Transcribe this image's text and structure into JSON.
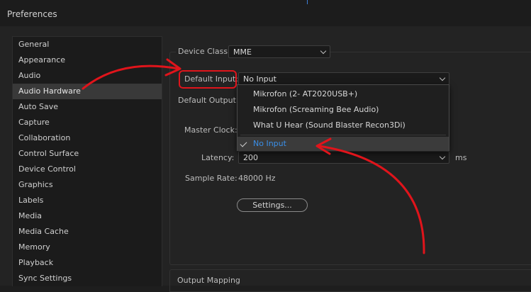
{
  "window": {
    "title": "Preferences"
  },
  "sidebar": {
    "items": [
      {
        "label": "General"
      },
      {
        "label": "Appearance"
      },
      {
        "label": "Audio"
      },
      {
        "label": "Audio Hardware"
      },
      {
        "label": "Auto Save"
      },
      {
        "label": "Capture"
      },
      {
        "label": "Collaboration"
      },
      {
        "label": "Control Surface"
      },
      {
        "label": "Device Control"
      },
      {
        "label": "Graphics"
      },
      {
        "label": "Labels"
      },
      {
        "label": "Media"
      },
      {
        "label": "Media Cache"
      },
      {
        "label": "Memory"
      },
      {
        "label": "Playback"
      },
      {
        "label": "Sync Settings"
      }
    ],
    "selected": "Audio Hardware"
  },
  "audio_hardware": {
    "device_class": {
      "label": "Device Class:",
      "value": "MME"
    },
    "default_input": {
      "label": "Default Input:",
      "value": "No Input",
      "options": [
        {
          "label": "Mikrofon (2- AT2020USB+)"
        },
        {
          "label": "Mikrofon (Screaming Bee Audio)"
        },
        {
          "label": "What U Hear (Sound Blaster Recon3Di)"
        },
        {
          "label": "No Input"
        }
      ]
    },
    "default_output": {
      "label": "Default Output:"
    },
    "master_clock": {
      "label": "Master Clock:"
    },
    "latency": {
      "label": "Latency:",
      "value": "200",
      "unit": "ms"
    },
    "sample_rate": {
      "label": "Sample Rate:",
      "value": "48000 Hz"
    },
    "settings_button": {
      "label": "Settings..."
    },
    "output_mapping": {
      "label": "Output Mapping"
    }
  },
  "colors": {
    "annotation": "#e0141b",
    "selected_option": "#3a8fe8"
  }
}
